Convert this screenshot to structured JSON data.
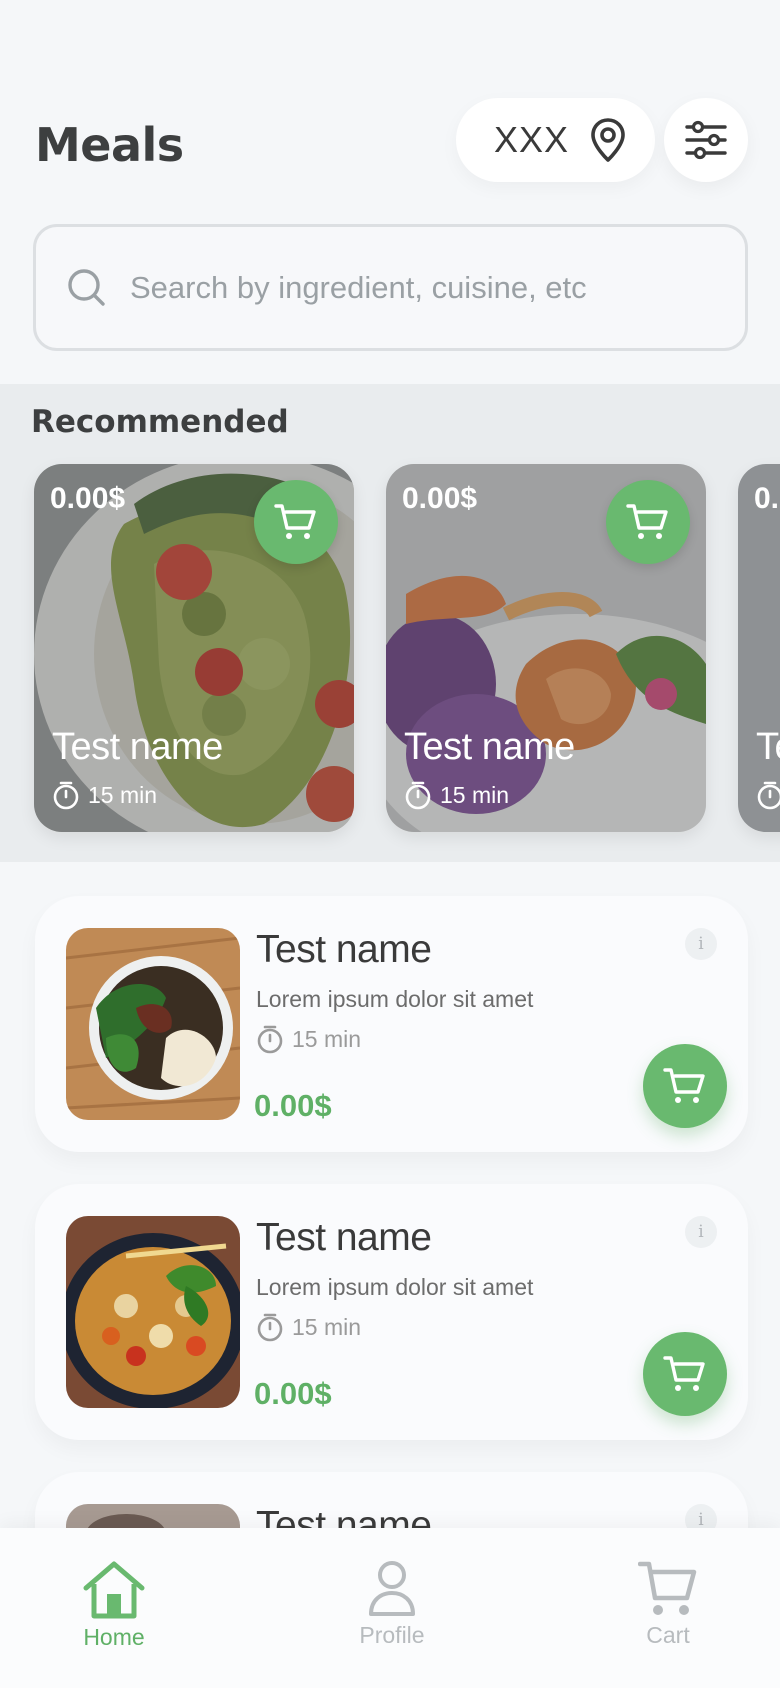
{
  "header": {
    "title": "Meals",
    "location": "XXX"
  },
  "search": {
    "placeholder": "Search by ingredient, cuisine, etc"
  },
  "recommended": {
    "title": "Recommended",
    "items": [
      {
        "price": "0.00$",
        "name": "Test name",
        "time": "15 min"
      },
      {
        "price": "0.00$",
        "name": "Test name",
        "time": "15 min"
      },
      {
        "price": "0.",
        "name": "Te",
        "time": ""
      }
    ]
  },
  "meals": [
    {
      "name": "Test name",
      "description": "Lorem ipsum dolor sit amet",
      "time": "15 min",
      "price": "0.00$",
      "info": "i"
    },
    {
      "name": "Test name",
      "description": "Lorem ipsum dolor sit amet",
      "time": "15 min",
      "price": "0.00$",
      "info": "i"
    },
    {
      "name": "Test name",
      "description": "",
      "time": "",
      "price": "",
      "info": "i"
    }
  ],
  "nav": {
    "home": "Home",
    "profile": "Profile",
    "cart": "Cart"
  },
  "colors": {
    "accent": "#69b96f",
    "price_green": "#5fb066",
    "background": "#f5f7f9"
  },
  "icons": [
    "location-pin-icon",
    "filter-sliders-icon",
    "search-icon",
    "cart-icon",
    "timer-icon",
    "info-icon",
    "home-icon",
    "profile-icon"
  ]
}
